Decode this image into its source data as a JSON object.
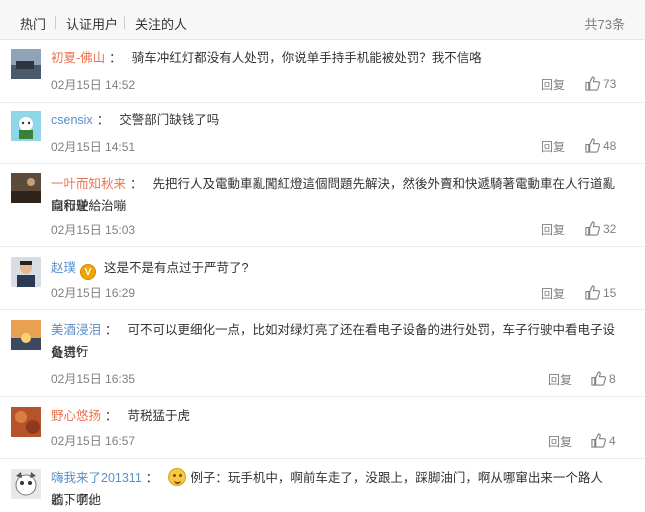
{
  "tabs": [
    "热门",
    "认证用户",
    "关注的人"
  ],
  "total": "共73条",
  "reply_label": "回复",
  "comments": [
    {
      "user": "初夏-佛山",
      "text": "骑车冲红灯都没有人处罚，你说单手持手机能被处罚？我不信咯",
      "line2": "",
      "time": "02月15日 14:52",
      "likes": "73"
    },
    {
      "user": "csensix",
      "text": "交警部门缺钱了吗",
      "line2": "",
      "time": "02月15日 14:51",
      "likes": "48"
    },
    {
      "user": "一叶而知秋来",
      "text": "先把行人及電動車亂闖紅燈這個問題先解決，然後外賣和快遞騎著電動車在人行道亂竄和逆",
      "line2": "向行駛給治嘣",
      "time": "02月15日 15:03",
      "likes": "32"
    },
    {
      "user": "赵璞",
      "text": "这是不是有点过于严苛了?",
      "line2": "",
      "time": "02月15日 16:29",
      "likes": "15"
    },
    {
      "user": "美酒浸泪",
      "text": "可不可以更细化一点，比如对绿灯亮了还在看电子设备的进行处罚，车子行驶中看电子设备进行",
      "line2": "处罚?",
      "time": "02月15日 16:35",
      "likes": "8"
    },
    {
      "user": "野心悠扬",
      "text": "苛税猛于虎",
      "line2": "",
      "time": "02月15日 16:57",
      "likes": "4"
    },
    {
      "user": "嗨我来了201311",
      "text": "例子：玩手机中，啊前车走了，没跟上，踩脚油门，啊从哪窜出来一个路人乙，啊他",
      "line2": "躺下了。",
      "time": "",
      "likes": ""
    }
  ],
  "verified_badge": "V",
  "colors": {
    "accent_user": "#eb7350",
    "link_user": "#5a8fc8",
    "meta": "#808080"
  }
}
